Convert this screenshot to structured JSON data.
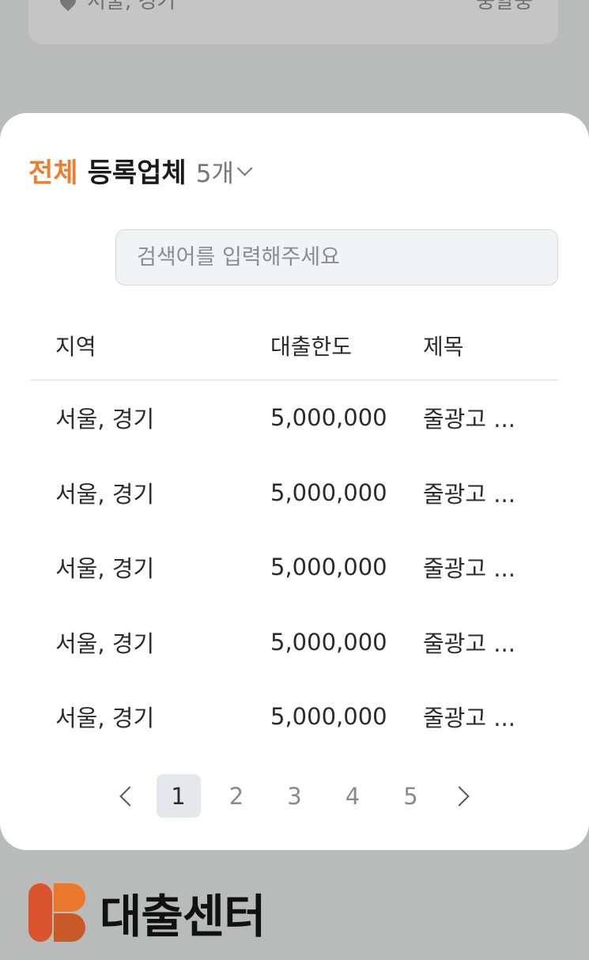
{
  "background_card": {
    "location": "서울, 경기",
    "right_text": "중할중"
  },
  "sheet": {
    "heading_accent": "전체",
    "heading_title": "등록업체",
    "count_label": "5개",
    "search_placeholder": "검색어를 입력해주세요",
    "columns": [
      "지역",
      "대출한도",
      "제목"
    ],
    "rows": [
      {
        "region": "서울, 경기",
        "limit": "5,000,000",
        "title": "줄광고 ..."
      },
      {
        "region": "서울, 경기",
        "limit": "5,000,000",
        "title": "줄광고 ..."
      },
      {
        "region": "서울, 경기",
        "limit": "5,000,000",
        "title": "줄광고 ..."
      },
      {
        "region": "서울, 경기",
        "limit": "5,000,000",
        "title": "줄광고 ..."
      },
      {
        "region": "서울, 경기",
        "limit": "5,000,000",
        "title": "줄광고 ..."
      }
    ],
    "pagination": {
      "pages": [
        "1",
        "2",
        "3",
        "4",
        "5"
      ],
      "current": "1"
    }
  },
  "footer": {
    "brand": "대출센터"
  },
  "colors": {
    "accent": "#ee7d2f",
    "backdrop": "#b9baba",
    "active_page_bg": "#e5e8eb"
  }
}
